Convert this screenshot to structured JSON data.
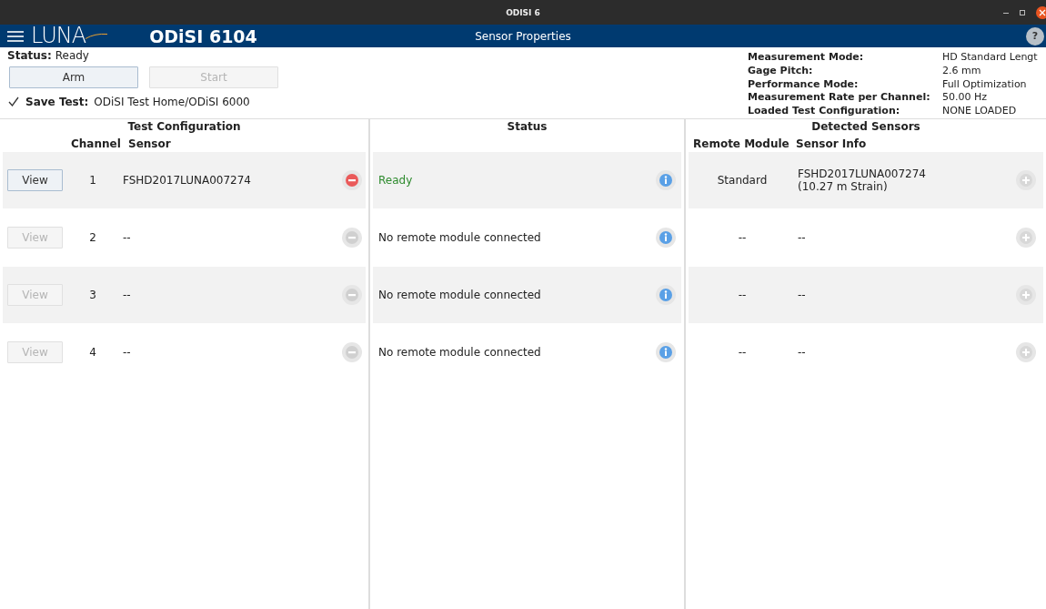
{
  "window": {
    "title": "ODISI 6"
  },
  "app_bar": {
    "logo": "LUNA",
    "product": "ODiSI 6104",
    "page_title": "Sensor Properties",
    "help": "?"
  },
  "status": {
    "label": "Status:",
    "value": "Ready"
  },
  "buttons": [
    {
      "label": "Arm",
      "disabled": false
    },
    {
      "label": "Start",
      "disabled": true
    }
  ],
  "save_test": {
    "checked": true,
    "label": "Save Test:",
    "path": "ODiSI Test Home/ODiSI 6000"
  },
  "settings": [
    {
      "label": "Measurement Mode:",
      "value": "HD Standard Lengt"
    },
    {
      "label": "Gage Pitch:",
      "value": "2.6 mm"
    },
    {
      "label": "Performance Mode:",
      "value": "Full Optimization"
    },
    {
      "label": "Measurement Rate per Channel:",
      "value": "50.00 Hz"
    },
    {
      "label": "Loaded Test Configuration:",
      "value": "NONE LOADED"
    }
  ],
  "panels": {
    "test_configuration": {
      "title": "Test Configuration",
      "columns": [
        "Channel",
        "Sensor"
      ]
    },
    "status": {
      "title": "Status"
    },
    "detected_sensors": {
      "title": "Detected Sensors",
      "columns": [
        "Remote Module",
        "Sensor Info"
      ]
    }
  },
  "channels": [
    {
      "view": "View",
      "view_disabled": false,
      "channel": "1",
      "sensor": "FSHD2017LUNA007274",
      "remove_disabled": false,
      "status": "Ready",
      "ready": true,
      "remote_module": "Standard",
      "sensor_info": "FSHD2017LUNA007274\n(10.27 m Strain)",
      "add_disabled": true
    },
    {
      "view": "View",
      "view_disabled": true,
      "channel": "2",
      "sensor": "--",
      "remove_disabled": true,
      "status": "No remote module connected",
      "ready": false,
      "remote_module": "--",
      "sensor_info": "--",
      "add_disabled": true
    },
    {
      "view": "View",
      "view_disabled": true,
      "channel": "3",
      "sensor": "--",
      "remove_disabled": true,
      "status": "No remote module connected",
      "ready": false,
      "remote_module": "--",
      "sensor_info": "--",
      "add_disabled": true
    },
    {
      "view": "View",
      "view_disabled": true,
      "channel": "4",
      "sensor": "--",
      "remove_disabled": true,
      "status": "No remote module connected",
      "ready": false,
      "remote_module": "--",
      "sensor_info": "--",
      "add_disabled": true
    }
  ]
}
